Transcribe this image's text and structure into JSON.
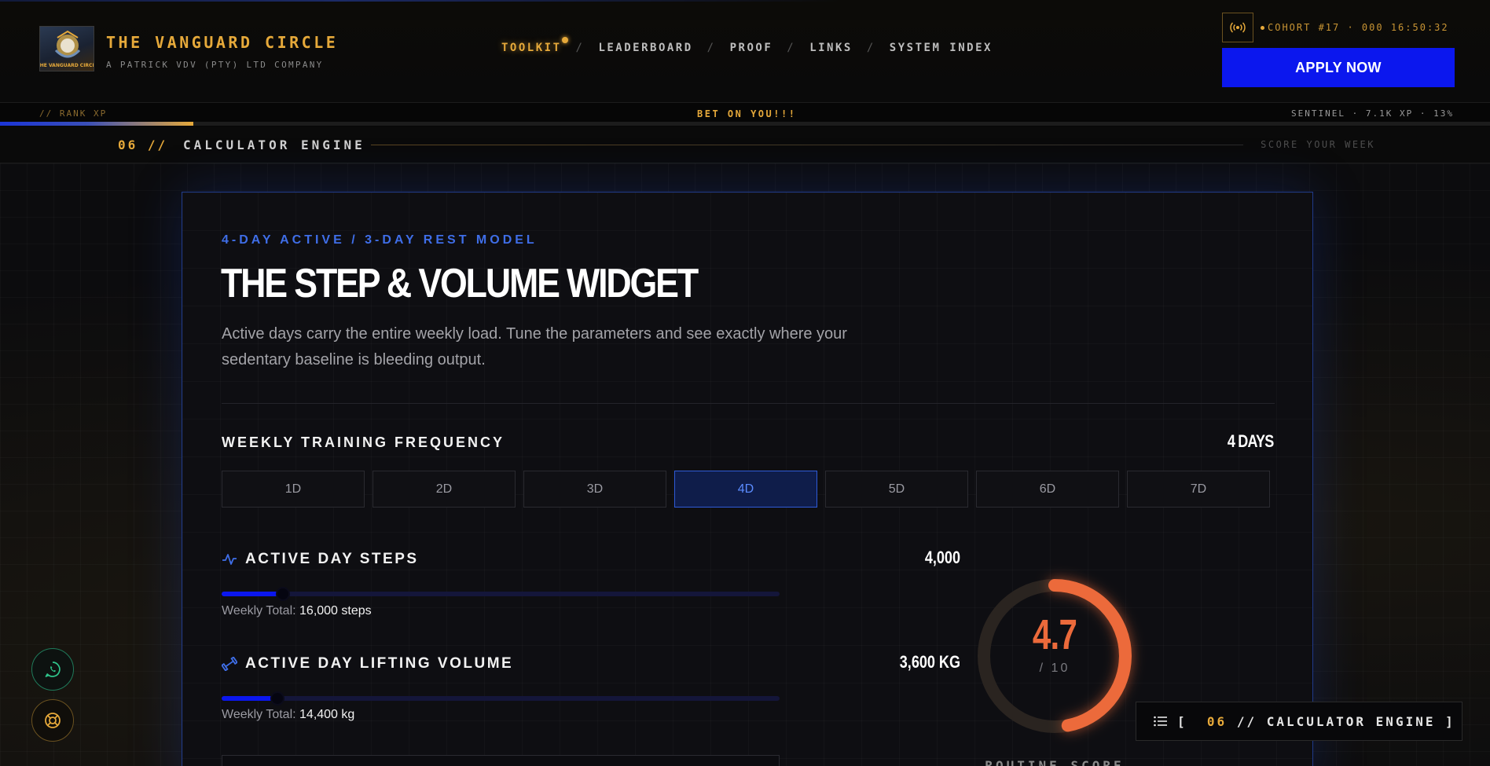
{
  "brand": {
    "title": "THE VANGUARD CIRCLE",
    "subtitle": "A PATRICK VDV (PTY) LTD COMPANY",
    "logo_text": "THE VANGUARD CIRCLE"
  },
  "nav": {
    "items": [
      "TOOLKIT",
      "LEADERBOARD",
      "PROOF",
      "LINKS",
      "SYSTEM INDEX"
    ],
    "active": "TOOLKIT",
    "separator": "/"
  },
  "header_right": {
    "signal_icon": "broadcast-icon",
    "cohort_text": "COHORT #17 · 000 16:50:32",
    "apply_label": "APPLY NOW"
  },
  "rank_bar": {
    "left": "// RANK XP",
    "center": "BET ON YOU!!!",
    "right": "SENTINEL · 7.1K XP · 13%",
    "progress_percent": 13
  },
  "section": {
    "number": "06 //",
    "title": "CALCULATOR ENGINE",
    "right": "SCORE YOUR WEEK"
  },
  "widget": {
    "eyebrow": "4-DAY ACTIVE / 3-DAY REST MODEL",
    "title": "THE STEP & VOLUME WIDGET",
    "description": "Active days carry the entire weekly load. Tune the parameters and see exactly where your sedentary baseline is bleeding output.",
    "frequency": {
      "label": "WEEKLY TRAINING FREQUENCY",
      "value": "4 DAYS",
      "options": [
        "1D",
        "2D",
        "3D",
        "4D",
        "5D",
        "6D",
        "7D"
      ],
      "selected": "4D"
    },
    "steps": {
      "icon": "activity-pulse-icon",
      "label": "ACTIVE DAY STEPS",
      "value": "4,000",
      "slider_fraction": 0.11,
      "weekly_prefix": "Weekly Total:",
      "weekly_value": "16,000 steps"
    },
    "lifting": {
      "icon": "dumbbell-icon",
      "label": "ACTIVE DAY LIFTING VOLUME",
      "value": "3,600 KG",
      "slider_fraction": 0.1,
      "weekly_prefix": "Weekly Total:",
      "weekly_value": "14,400 kg"
    },
    "score": {
      "value": "4.7",
      "denominator": "/ 10",
      "fraction": 0.47,
      "caption": "ROUTINE SCORE",
      "color": "#ec6a3b"
    }
  },
  "floating": {
    "whatsapp_icon": "whatsapp-icon",
    "help_icon": "lifebuoy-icon",
    "toc": {
      "icon": "list-icon",
      "open": "[",
      "number": "06",
      "text": "// CALCULATOR ENGINE ]"
    }
  },
  "colors": {
    "accent_gold": "#e6a93a",
    "accent_blue": "#0b17ee",
    "score_orange": "#ec6a3b"
  }
}
